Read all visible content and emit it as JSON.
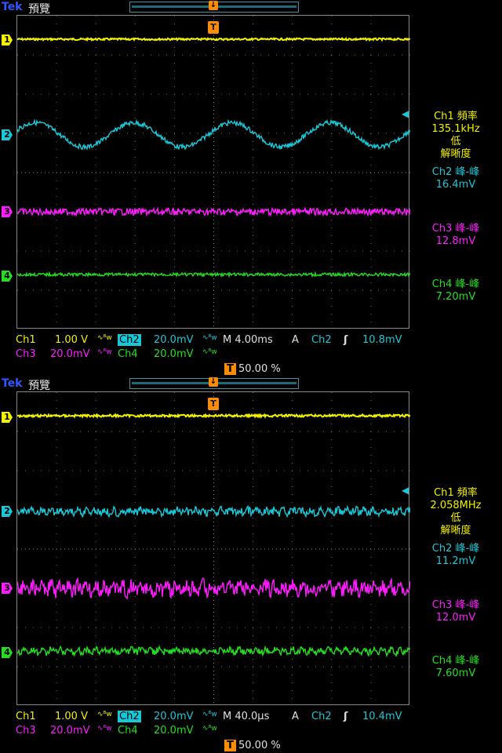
{
  "colors": {
    "ch1": "#f2f200",
    "ch2": "#18c8d8",
    "ch3": "#ff1aff",
    "ch4": "#22e01e",
    "trigger": "#ff8c00",
    "grid": "#6a6a6a"
  },
  "screens": [
    {
      "brand": "Tek",
      "mode": "預覽",
      "trigger_pos_label": "T",
      "channel_markers": [
        "1",
        "2",
        "3",
        "4"
      ],
      "measurements": {
        "ch1_label": "Ch1 頻率",
        "ch1_value": "135.1kHz",
        "ch1_low": "低",
        "ch1_res": "解晰度",
        "ch2_label": "Ch2 峰-峰",
        "ch2_value": "16.4mV",
        "ch3_label": "Ch3 峰-峰",
        "ch3_value": "12.8mV",
        "ch4_label": "Ch4 峰-峰",
        "ch4_value": "7.20mV"
      },
      "readout": {
        "ch1": "Ch1",
        "ch1_scale": "1.00 V",
        "ch2": "Ch2",
        "ch2_scale": "20.0mV",
        "ch3": "Ch3",
        "ch3_scale": "20.0mV",
        "ch4": "Ch4",
        "ch4_scale": "20.0mV",
        "bw_symbol": "∿ᴮw",
        "timebase": "M 4.00ms",
        "acq": "A",
        "trig_src": "Ch2",
        "trig_slope": "ʃ",
        "trig_level": "10.8mV",
        "trig_pos_label": "T",
        "trig_pos": "50.00 %"
      },
      "traces": {
        "ch2_cycles": 4,
        "ch2_amplitude_div": 0.31
      }
    },
    {
      "brand": "Tek",
      "mode": "預覽",
      "trigger_pos_label": "T",
      "channel_markers": [
        "1",
        "2",
        "3",
        "4"
      ],
      "measurements": {
        "ch1_label": "Ch1 頻率",
        "ch1_value": "2.058MHz",
        "ch1_low": "低",
        "ch1_res": "解晰度",
        "ch2_label": "Ch2 峰-峰",
        "ch2_value": "11.2mV",
        "ch3_label": "Ch3 峰-峰",
        "ch3_value": "12.0mV",
        "ch4_label": "Ch4 峰-峰",
        "ch4_value": "7.60mV"
      },
      "readout": {
        "ch1": "Ch1",
        "ch1_scale": "1.00 V",
        "ch2": "Ch2",
        "ch2_scale": "20.0mV",
        "ch3": "Ch3",
        "ch3_scale": "20.0mV",
        "ch4": "Ch4",
        "ch4_scale": "20.0mV",
        "bw_symbol": "∿ᴮw",
        "timebase": "M 40.0µs",
        "acq": "A",
        "trig_src": "Ch2",
        "trig_slope": "ʃ",
        "trig_level": "10.4mV",
        "trig_pos_label": "T",
        "trig_pos": "50.00 %"
      },
      "traces": {
        "ch2_cycles": 0,
        "ch2_amplitude_div": 0.1
      }
    }
  ]
}
